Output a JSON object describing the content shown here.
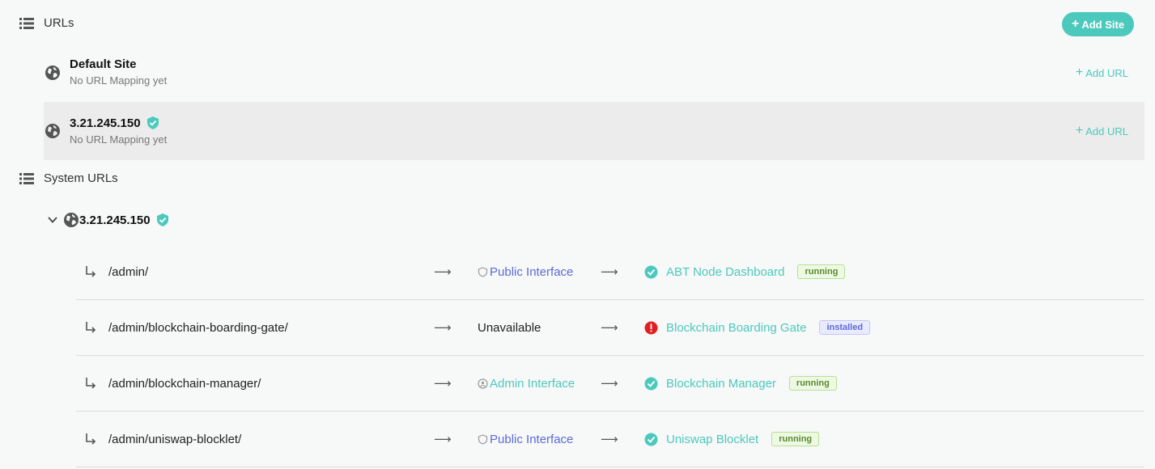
{
  "urls_section": {
    "title": "URLs",
    "add_site_label": "Add Site"
  },
  "sites": [
    {
      "name": "Default Site",
      "subtitle": "No URL Mapping yet",
      "add_url_label": "Add URL"
    },
    {
      "name": "3.21.245.150",
      "subtitle": "No URL Mapping yet",
      "add_url_label": "Add URL"
    }
  ],
  "system_section": {
    "title": "System URLs"
  },
  "system_site": {
    "name": "3.21.245.150"
  },
  "mappings": [
    {
      "path": "/admin/",
      "interface": "Public Interface",
      "app": "ABT Node Dashboard",
      "status": "running"
    },
    {
      "path": "/admin/blockchain-boarding-gate/",
      "interface": "Unavailable",
      "app": "Blockchain Boarding Gate",
      "status": "installed"
    },
    {
      "path": "/admin/blockchain-manager/",
      "interface": "Admin Interface",
      "app": "Blockchain Manager",
      "status": "running"
    },
    {
      "path": "/admin/uniswap-blocklet/",
      "interface": "Public Interface",
      "app": "Uniswap Blocklet",
      "status": "running"
    }
  ],
  "colors": {
    "accent": "#4cc9bd",
    "interface_link": "#5b6bd6",
    "error": "#e02020",
    "highlight_row": "#ececec"
  }
}
